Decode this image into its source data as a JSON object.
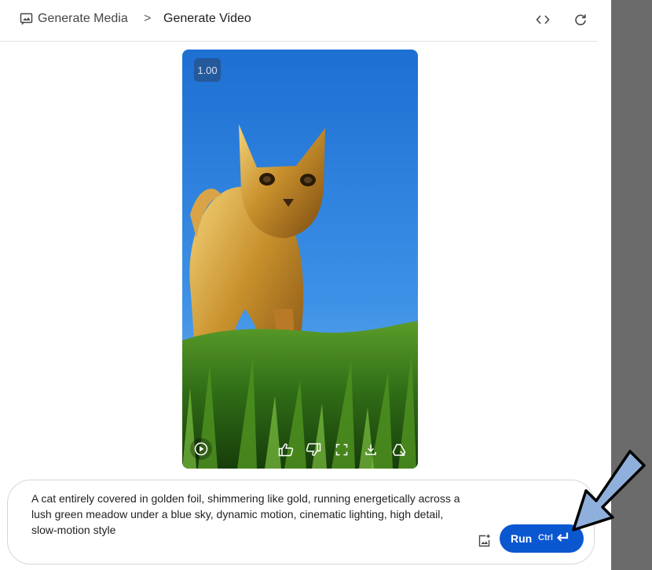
{
  "breadcrumb": {
    "root": "Generate Media",
    "separator": ">",
    "current": "Generate Video"
  },
  "header_icons": [
    "code-icon",
    "refresh-icon"
  ],
  "video": {
    "speed": "1.00",
    "subject": "golden foil cat running in grass under blue sky",
    "controls": [
      "play-icon",
      "thumbs-up-icon",
      "thumbs-down-icon",
      "fullscreen-icon",
      "download-icon",
      "drive-save-icon"
    ]
  },
  "prompt": {
    "text": "A cat entirely covered in golden foil, shimmering like gold, running energetically across a lush green meadow under a blue sky, dynamic motion, cinematic lighting, high detail, slow-motion style"
  },
  "run_button": {
    "label": "Run",
    "shortcut": "Ctrl"
  },
  "colors": {
    "accent": "#0b57d0",
    "annotation_arrow": "#8fb0dc",
    "side_panel": "#6b6b6b"
  }
}
